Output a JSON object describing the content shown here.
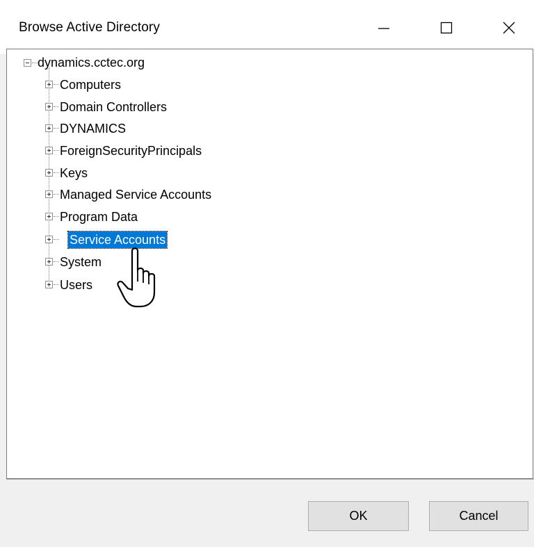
{
  "window": {
    "title": "Browse Active Directory",
    "controls": {
      "minimize_icon": "minimize-icon",
      "maximize_icon": "maximize-icon",
      "close_icon": "close-icon"
    }
  },
  "tree": {
    "root": {
      "label": "dynamics.cctec.org",
      "expanded": true,
      "children": [
        {
          "label": "Computers",
          "expanded": false,
          "selected": false
        },
        {
          "label": "Domain Controllers",
          "expanded": false,
          "selected": false
        },
        {
          "label": "DYNAMICS",
          "expanded": false,
          "selected": false
        },
        {
          "label": "ForeignSecurityPrincipals",
          "expanded": false,
          "selected": false
        },
        {
          "label": "Keys",
          "expanded": false,
          "selected": false
        },
        {
          "label": "Managed Service Accounts",
          "expanded": false,
          "selected": false
        },
        {
          "label": "Program Data",
          "expanded": false,
          "selected": false
        },
        {
          "label": "Service Accounts",
          "expanded": false,
          "selected": true
        },
        {
          "label": "System",
          "expanded": false,
          "selected": false
        },
        {
          "label": "Users",
          "expanded": false,
          "selected": false
        }
      ]
    }
  },
  "buttons": {
    "ok_label": "OK",
    "cancel_label": "Cancel"
  },
  "colors": {
    "selection": "#0078d7",
    "button_face": "#e1e1e1"
  },
  "cursor_icon": "hand-pointer-icon"
}
